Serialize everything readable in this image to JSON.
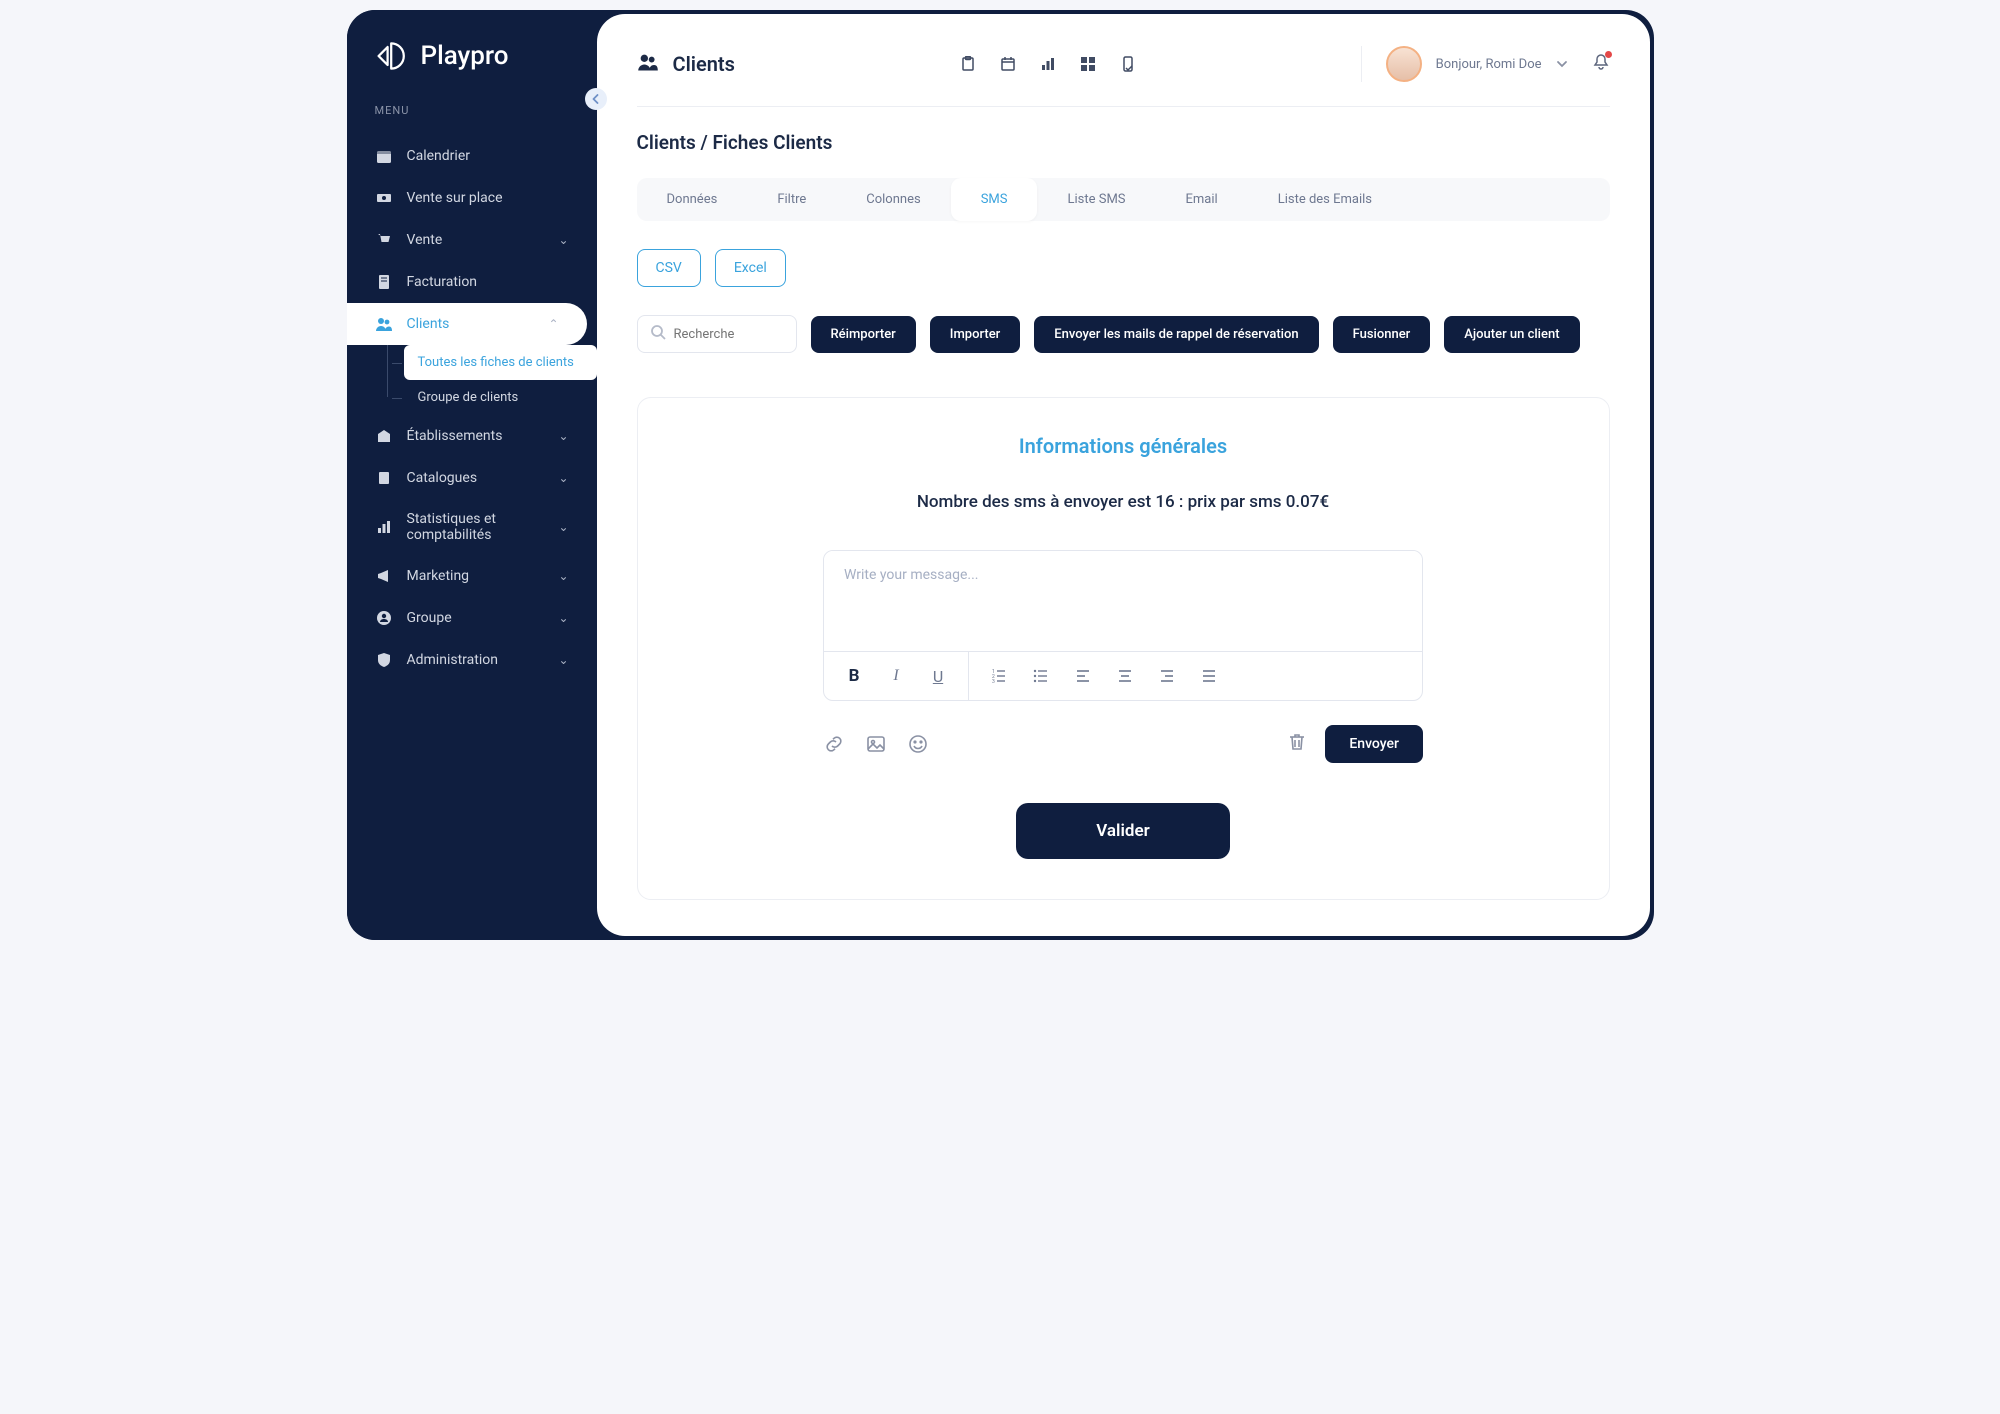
{
  "brand": "Playpro",
  "sidebar": {
    "menu_label": "MENU",
    "items": [
      {
        "label": "Calendrier"
      },
      {
        "label": "Vente sur place"
      },
      {
        "label": "Vente",
        "chev": true
      },
      {
        "label": "Facturation"
      },
      {
        "label": "Clients",
        "chev": true
      },
      {
        "label": "Établissements",
        "chev": true
      },
      {
        "label": "Catalogues",
        "chev": true
      },
      {
        "label": "Statistiques et comptabilités",
        "chev": true
      },
      {
        "label": "Marketing",
        "chev": true
      },
      {
        "label": "Groupe",
        "chev": true
      },
      {
        "label": "Administration",
        "chev": true
      }
    ],
    "clients_sub": [
      "Toutes les fiches de clients",
      "Groupe de clients"
    ]
  },
  "header": {
    "title": "Clients",
    "greeting": "Bonjour, Romi Doe"
  },
  "breadcrumb": "Clients / Fiches Clients",
  "tabs": [
    "Données",
    "Filtre",
    "Colonnes",
    "SMS",
    "Liste SMS",
    "Email",
    "Liste des Emails"
  ],
  "active_tab_index": 3,
  "export": {
    "csv": "CSV",
    "excel": "Excel"
  },
  "search": {
    "placeholder": "Recherche"
  },
  "actions": {
    "reimport": "Réimporter",
    "import": "Importer",
    "send_reminder": "Envoyer les mails de rappel de réservation",
    "merge": "Fusionner",
    "add_client": "Ajouter un client"
  },
  "card": {
    "title": "Informations générales",
    "sms_info": "Nombre des sms à envoyer est 16 : prix par sms 0.07€",
    "message_placeholder": "Write your message...",
    "send_button": "Envoyer",
    "validate_button": "Valider"
  }
}
